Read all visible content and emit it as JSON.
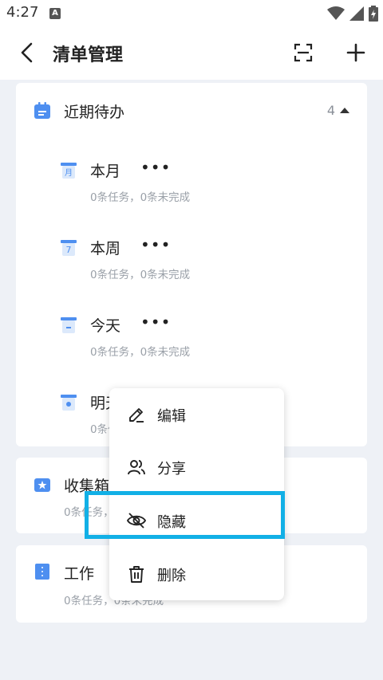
{
  "status_bar": {
    "time": "4:27",
    "notification_badge": "A"
  },
  "app_bar": {
    "title": "清单管理",
    "back_icon": "chevron-left-icon",
    "scan_icon": "scan-icon",
    "add_icon": "plus-icon"
  },
  "groups": {
    "recent": {
      "title": "近期待办",
      "count": "4",
      "items": [
        {
          "label": "本月",
          "desc": "0条任务，0条未完成",
          "icon": "calendar-month-icon"
        },
        {
          "label": "本周",
          "desc": "0条任务，0条未完成",
          "icon": "calendar-week-icon"
        },
        {
          "label": "今天",
          "desc": "0条任务，0条未完成",
          "icon": "calendar-today-icon"
        },
        {
          "label": "明天",
          "desc": "0条任务，0条未完成",
          "icon": "calendar-tomorrow-icon"
        }
      ]
    },
    "inbox": {
      "title": "收集箱",
      "desc": "0条任务，0条未完成"
    },
    "work": {
      "title": "工作",
      "desc": "0条任务，0条未完成"
    }
  },
  "context_menu": {
    "items": [
      {
        "label": "编辑",
        "icon": "pencil-icon"
      },
      {
        "label": "分享",
        "icon": "people-icon"
      },
      {
        "label": "隐藏",
        "icon": "eye-off-icon"
      },
      {
        "label": "删除",
        "icon": "trash-icon"
      }
    ]
  },
  "colors": {
    "accent": "#4e8ff0",
    "highlight": "#12b0e6",
    "background": "#eef1f6"
  }
}
